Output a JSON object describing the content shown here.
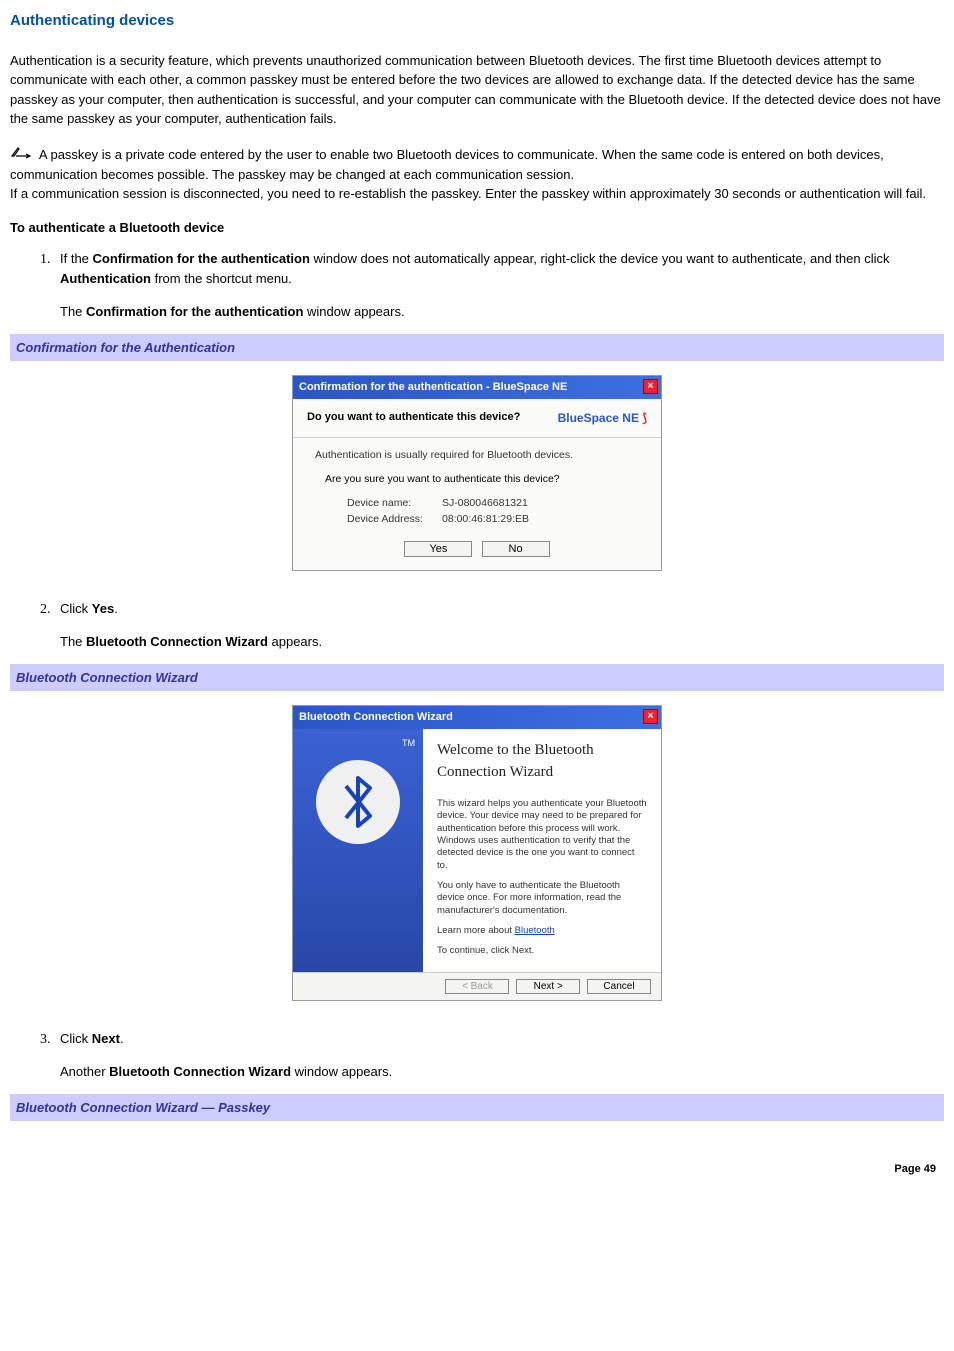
{
  "title": "Authenticating devices",
  "intro": "Authentication is a security feature, which prevents unauthorized communication between Bluetooth    devices. The first time Bluetooth devices attempt to communicate with each other, a common passkey must be entered before the two devices are allowed to exchange data. If the detected device has the same passkey as your computer, then authentication is successful, and your computer can communicate with the Bluetooth device. If the detected device does not have the same passkey as your computer, authentication fails.",
  "note1": "A passkey is a private code entered by the user to enable two Bluetooth devices to communicate. When the same code is entered on both devices, communication becomes possible. The passkey may be changed at each communication session.",
  "note2": "If a communication session is disconnected, you need to re-establish the passkey. Enter the passkey within approximately 30 seconds or authentication will fail.",
  "subheading": "To authenticate a Bluetooth device",
  "steps": {
    "s1a": "If the ",
    "s1b": "Confirmation for the authentication",
    "s1c": " window does not automatically appear, right-click the device you want to authenticate, and then click ",
    "s1d": "Authentication",
    "s1e": " from the shortcut menu.",
    "s1_sub_a": "The ",
    "s1_sub_b": "Confirmation for the authentication",
    "s1_sub_c": " window appears.",
    "s2a": "Click ",
    "s2b": "Yes",
    "s2c": ".",
    "s2_sub_a": "The ",
    "s2_sub_b": "Bluetooth Connection Wizard",
    "s2_sub_c": " appears.",
    "s3a": "Click ",
    "s3b": "Next",
    "s3c": ".",
    "s3_sub_a": "Another ",
    "s3_sub_b": "Bluetooth Connection Wizard",
    "s3_sub_c": " window appears."
  },
  "caption1": "Confirmation for the Authentication",
  "caption2": "Bluetooth Connection Wizard",
  "caption3": "Bluetooth Connection Wizard — Passkey",
  "dialog1": {
    "title": "Confirmation for the authentication - BlueSpace NE",
    "question": "Do you want to authenticate this device?",
    "brand_text": "BlueSpace NE",
    "line1": "Authentication is usually required for Bluetooth devices.",
    "line2": "Are you sure you want to authenticate this device?",
    "k1": "Device name:",
    "v1": "SJ-080046681321",
    "k2": "Device Address:",
    "v2": "08:00:46:81:29:EB",
    "yes": "Yes",
    "no": "No"
  },
  "dialog2": {
    "title": "Bluetooth Connection Wizard",
    "tm": "TM",
    "heading": "Welcome to the Bluetooth Connection Wizard",
    "p1": "This wizard helps you authenticate your Bluetooth device. Your device may need to be prepared for authentication before this process will work. Windows uses authentication to verify that the detected device is the one you want to connect to.",
    "p2": "You only have to authenticate the Bluetooth device once. For more information, read the manufacturer's documentation.",
    "learn_prefix": "Learn more about ",
    "learn_link": "Bluetooth",
    "cont": "To continue, click Next.",
    "back": "< Back",
    "next": "Next >",
    "cancel": "Cancel"
  },
  "page_label": "Page 49"
}
